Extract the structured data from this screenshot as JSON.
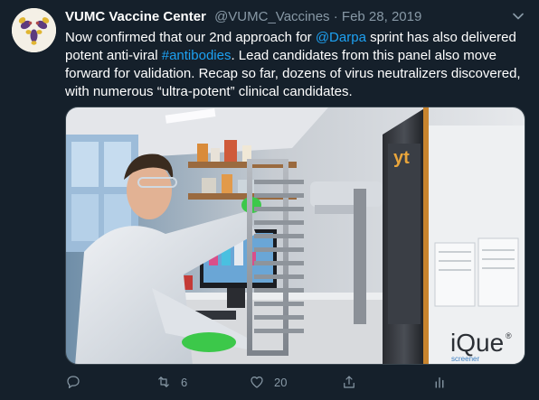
{
  "tweet": {
    "display_name": "VUMC Vaccine Center",
    "handle": "@VUMC_Vaccines",
    "separator": " · ",
    "date": "Feb 28, 2019",
    "text": {
      "part1": "Now confirmed that our 2nd approach for ",
      "mention": "@Darpa",
      "part2": " sprint has also delivered potent anti-viral ",
      "hashtag": "#antibodies",
      "part3": ".  Lead candidates from this panel also move forward for validation.  Recap so far, dozens of virus neutralizers discovered, with numerous “ultra-potent” clinical candidates."
    },
    "media_labels": {
      "brand": "iQue",
      "brand_sub": "screener",
      "brand_reg": "®",
      "tower_mark": "yt"
    },
    "actions": {
      "reply_icon": "reply-icon",
      "retweet_icon": "retweet-icon",
      "retweet_count": "6",
      "like_icon": "heart-icon",
      "like_count": "20",
      "share_icon": "share-icon",
      "analytics_icon": "analytics-icon"
    }
  },
  "colors": {
    "background": "#15202b",
    "text": "#ffffff",
    "muted": "#8899a6",
    "link": "#1da1f2"
  }
}
